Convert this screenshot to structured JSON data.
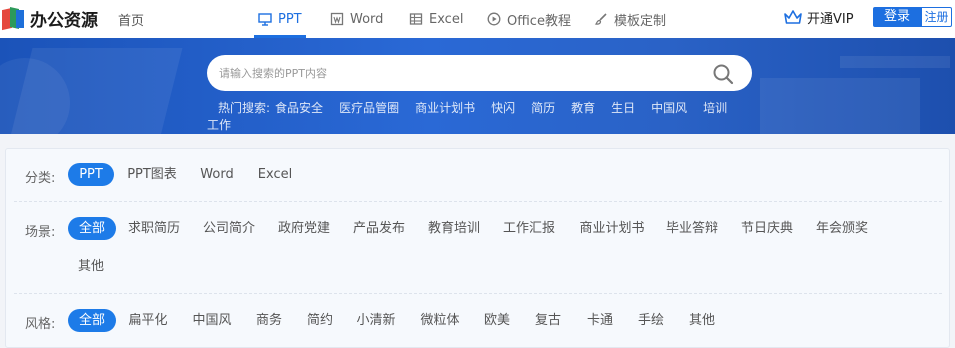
{
  "header": {
    "logo_text": "办公资源",
    "home": "首页",
    "nav": [
      {
        "label": "PPT",
        "icon": "presentation-icon",
        "active": true
      },
      {
        "label": "Word",
        "icon": "word-doc-icon",
        "active": false
      },
      {
        "label": "Excel",
        "icon": "spreadsheet-icon",
        "active": false
      },
      {
        "label": "Office教程",
        "icon": "play-circle-icon",
        "active": false
      },
      {
        "label": "模板定制",
        "icon": "brush-icon",
        "active": false
      }
    ],
    "vip": "开通VIP",
    "login": "登录",
    "register": "注册"
  },
  "hero": {
    "search_placeholder": "请输入搜索的PPT内容",
    "hot_label": "热门搜索:",
    "hot_keywords": [
      "食品安全",
      "医疗品管圈",
      "商业计划书",
      "快闪",
      "简历",
      "教育",
      "生日",
      "中国风",
      "培训",
      "工作"
    ]
  },
  "filters": {
    "category": {
      "label": "分类:",
      "options": [
        "PPT",
        "PPT图表",
        "Word",
        "Excel"
      ],
      "selected": 0
    },
    "scene": {
      "label": "场景:",
      "options": [
        "全部",
        "求职简历",
        "公司简介",
        "政府党建",
        "产品发布",
        "教育培训",
        "工作汇报",
        "商业计划书",
        "毕业答辩",
        "节日庆典",
        "年会颁奖",
        "其他"
      ],
      "selected": 0
    },
    "style": {
      "label": "风格:",
      "options": [
        "全部",
        "扁平化",
        "中国风",
        "商务",
        "简约",
        "小清新",
        "微粒体",
        "欧美",
        "复古",
        "卡通",
        "手绘",
        "其他"
      ],
      "selected": 0
    }
  },
  "colors": {
    "accent": "#1d6fe0",
    "hero_bg": "#2a69d6",
    "pill_active": "#1d7be8"
  }
}
